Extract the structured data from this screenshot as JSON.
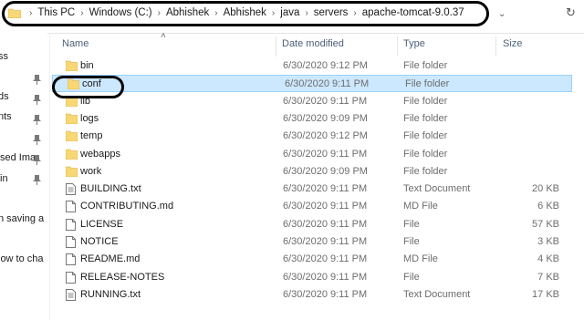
{
  "address_bar": {
    "crumbs": [
      "This PC",
      "Windows (C:)",
      "Abhishek",
      "Abhishek",
      "java",
      "servers",
      "apache-tomcat-9.0.37"
    ]
  },
  "nav": {
    "items": [
      "ss",
      "ds",
      "nts",
      "sed Ima",
      "in",
      "n saving a",
      "low to cha"
    ]
  },
  "columns": {
    "name": "Name",
    "date": "Date modified",
    "type": "Type",
    "size": "Size"
  },
  "files": [
    {
      "name": "bin",
      "date": "6/30/2020 9:12 PM",
      "type": "File folder",
      "size": "",
      "kind": "folder"
    },
    {
      "name": "conf",
      "date": "6/30/2020 9:11 PM",
      "type": "File folder",
      "size": "",
      "kind": "folder"
    },
    {
      "name": "lib",
      "date": "6/30/2020 9:11 PM",
      "type": "File folder",
      "size": "",
      "kind": "folder"
    },
    {
      "name": "logs",
      "date": "6/30/2020 9:09 PM",
      "type": "File folder",
      "size": "",
      "kind": "folder"
    },
    {
      "name": "temp",
      "date": "6/30/2020 9:12 PM",
      "type": "File folder",
      "size": "",
      "kind": "folder"
    },
    {
      "name": "webapps",
      "date": "6/30/2020 9:11 PM",
      "type": "File folder",
      "size": "",
      "kind": "folder"
    },
    {
      "name": "work",
      "date": "6/30/2020 9:09 PM",
      "type": "File folder",
      "size": "",
      "kind": "folder"
    },
    {
      "name": "BUILDING.txt",
      "date": "6/30/2020 9:11 PM",
      "type": "Text Document",
      "size": "20 KB",
      "kind": "text"
    },
    {
      "name": "CONTRIBUTING.md",
      "date": "6/30/2020 9:11 PM",
      "type": "MD File",
      "size": "6 KB",
      "kind": "file"
    },
    {
      "name": "LICENSE",
      "date": "6/30/2020 9:11 PM",
      "type": "File",
      "size": "57 KB",
      "kind": "file"
    },
    {
      "name": "NOTICE",
      "date": "6/30/2020 9:11 PM",
      "type": "File",
      "size": "3 KB",
      "kind": "file"
    },
    {
      "name": "README.md",
      "date": "6/30/2020 9:11 PM",
      "type": "MD File",
      "size": "4 KB",
      "kind": "file"
    },
    {
      "name": "RELEASE-NOTES",
      "date": "6/30/2020 9:11 PM",
      "type": "File",
      "size": "7 KB",
      "kind": "file"
    },
    {
      "name": "RUNNING.txt",
      "date": "6/30/2020 9:11 PM",
      "type": "Text Document",
      "size": "17 KB",
      "kind": "text"
    }
  ],
  "selected_file": "conf",
  "colors": {
    "folder": "#f8d775",
    "selection": "#cce8ff",
    "header_text": "#4c607a"
  }
}
